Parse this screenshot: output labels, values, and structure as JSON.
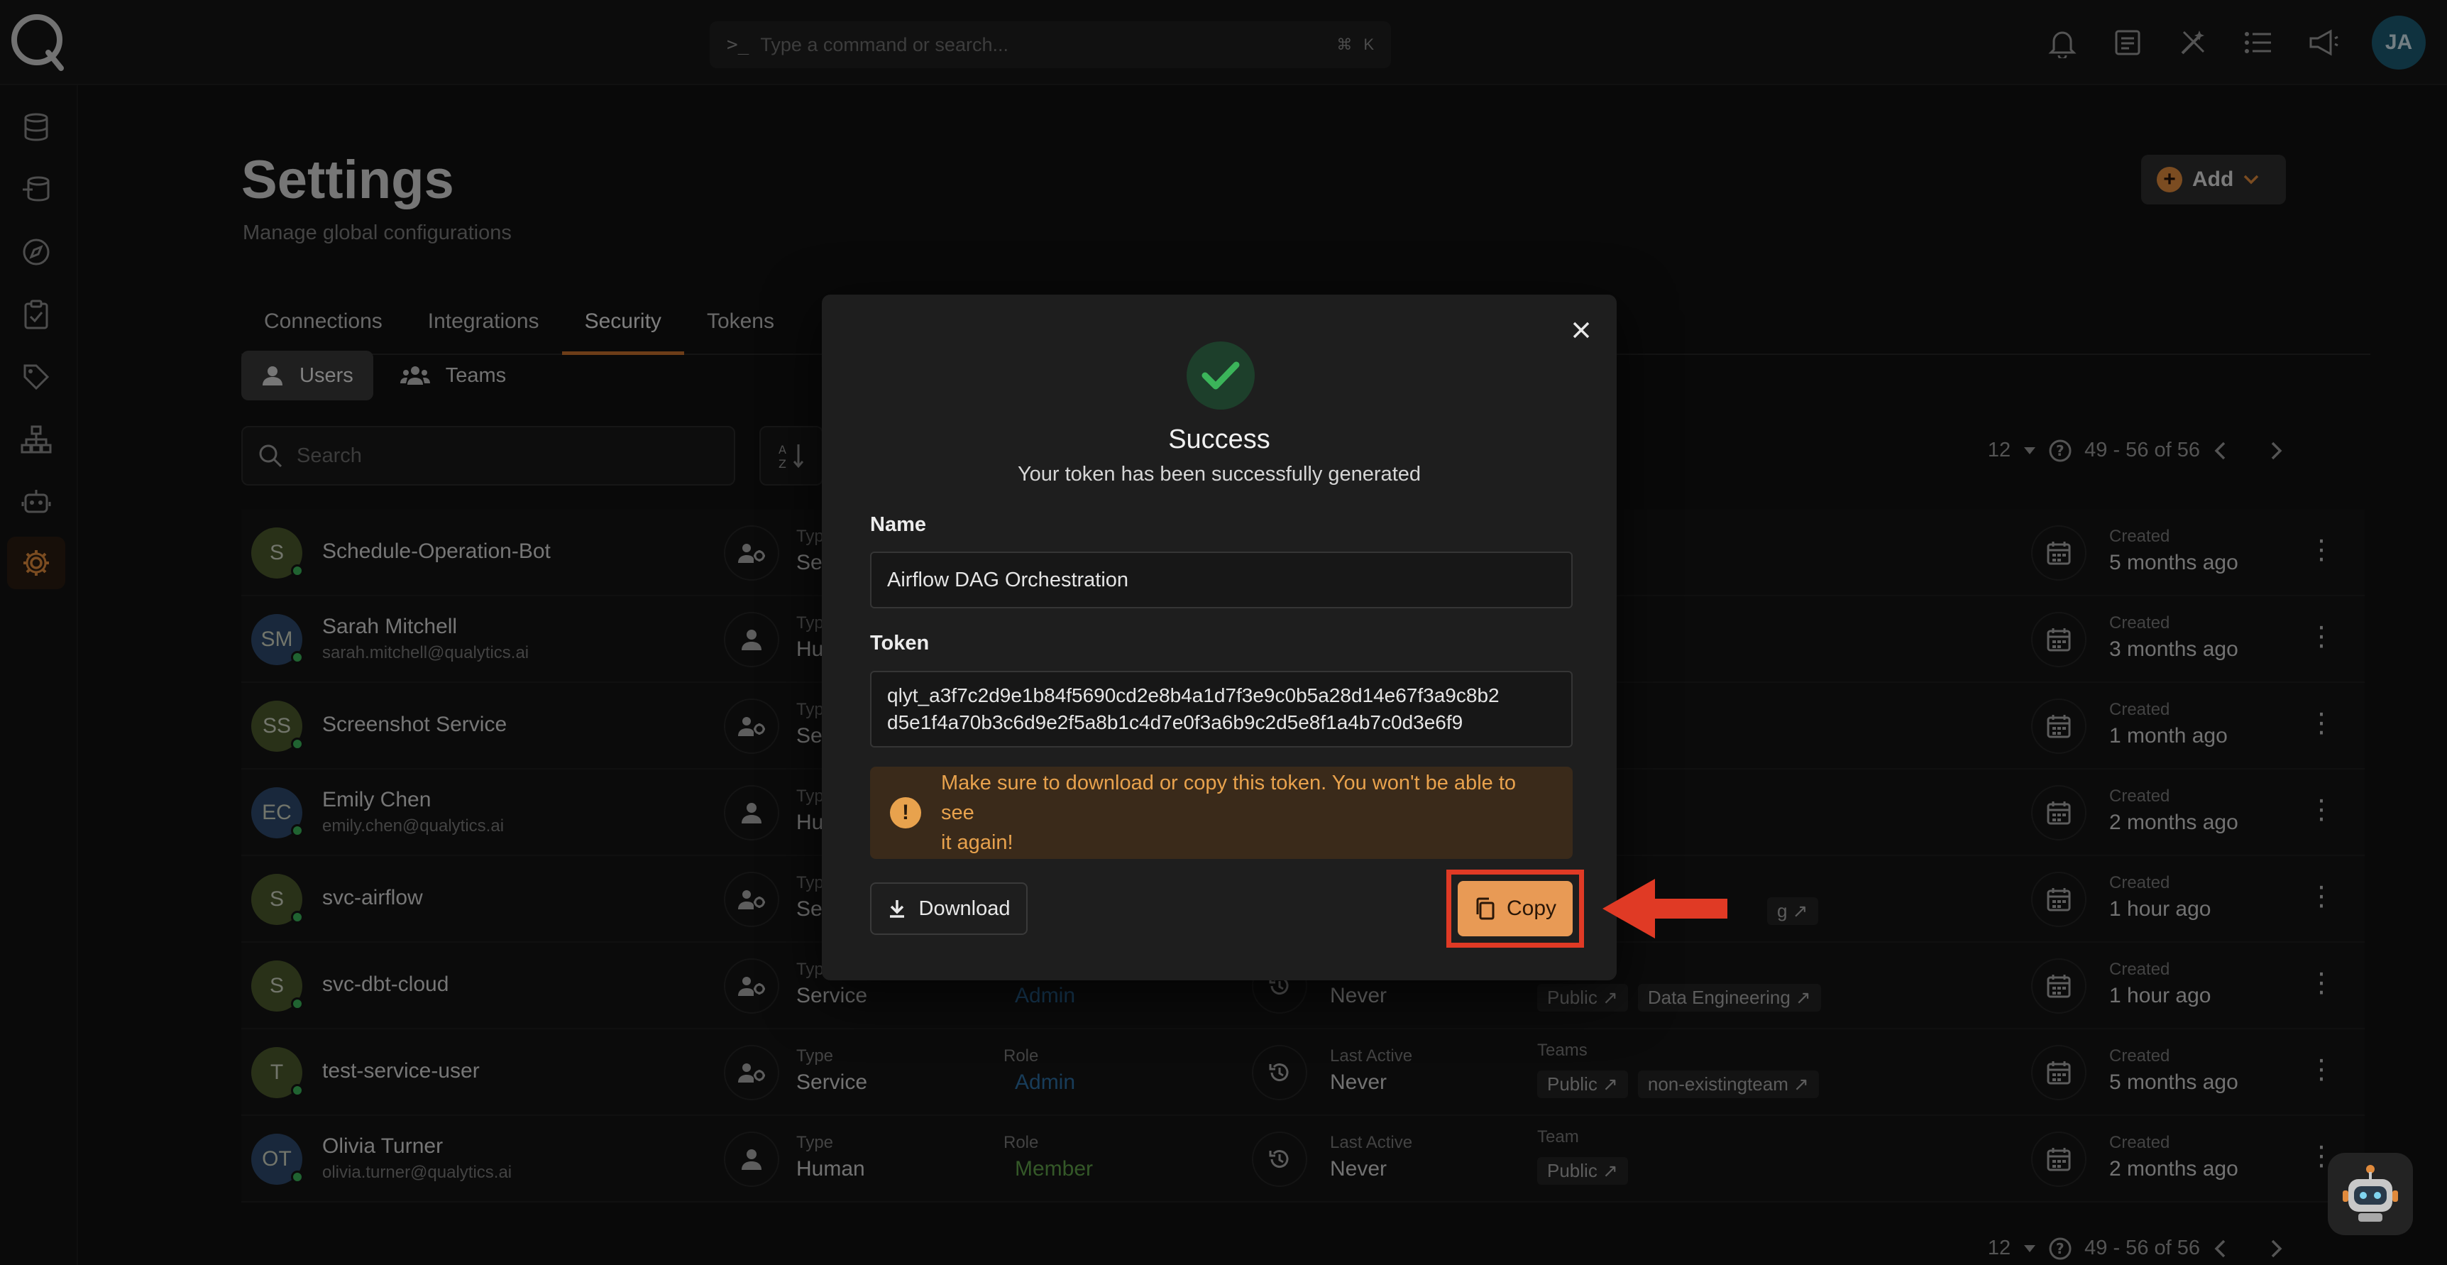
{
  "app": {
    "user_initials": "JA"
  },
  "command_bar": {
    "placeholder": "Type a command or search...",
    "prompt_glyph": ">_",
    "shortcut_cmd": "⌘",
    "shortcut_key": "K"
  },
  "page": {
    "title": "Settings",
    "subtitle": "Manage global configurations",
    "add_label": "Add"
  },
  "tabs": [
    {
      "label": "Connections"
    },
    {
      "label": "Integrations"
    },
    {
      "label": "Security",
      "active": true
    },
    {
      "label": "Tokens"
    }
  ],
  "segments": {
    "users": "Users",
    "teams": "Teams"
  },
  "search": {
    "placeholder": "Search"
  },
  "pagination": {
    "page_size": "12",
    "range": "49 - 56 of 56"
  },
  "labels": {
    "type": "Type",
    "role": "Role",
    "last_active": "Last Active",
    "teams": "Teams",
    "team": "Team",
    "created": "Created"
  },
  "users": [
    {
      "initials": "S",
      "name": "Schedule-Operation-Bot",
      "email": "",
      "type": "Service",
      "role": "",
      "last_active": "",
      "teams_label": "",
      "teams": [],
      "created": "5 months ago",
      "avatar_color": "#4b5a2d"
    },
    {
      "initials": "SM",
      "name": "Sarah Mitchell",
      "email": "sarah.mitchell@qualytics.ai",
      "type": "Human",
      "role": "",
      "last_active": "",
      "teams_label": "",
      "teams": [],
      "created": "3 months ago",
      "avatar_color": "#2f4a6e"
    },
    {
      "initials": "SS",
      "name": "Screenshot Service",
      "email": "",
      "type": "Service",
      "role": "",
      "last_active": "",
      "teams_label": "",
      "teams": [],
      "created": "1 month ago",
      "avatar_color": "#4b5a2d"
    },
    {
      "initials": "EC",
      "name": "Emily Chen",
      "email": "emily.chen@qualytics.ai",
      "type": "Human",
      "role": "",
      "last_active": "",
      "teams_label": "",
      "teams": [],
      "created": "2 months ago",
      "avatar_color": "#2f4a6e"
    },
    {
      "initials": "S",
      "name": "svc-airflow",
      "email": "",
      "type": "Service",
      "role": "",
      "last_active": "",
      "teams_label": "",
      "teams": [
        "g"
      ],
      "created": "1 hour ago",
      "avatar_color": "#4b5a2d"
    },
    {
      "initials": "S",
      "name": "svc-dbt-cloud",
      "email": "",
      "type": "Service",
      "role": "Admin",
      "last_active": "Never",
      "teams_label": "",
      "teams": [
        "Public",
        "Data Engineering"
      ],
      "created": "1 hour ago",
      "avatar_color": "#4b5a2d"
    },
    {
      "initials": "T",
      "name": "test-service-user",
      "email": "",
      "type": "Service",
      "role": "Admin",
      "last_active": "Never",
      "teams_label": "Teams",
      "teams": [
        "Public",
        "non-existingteam"
      ],
      "created": "5 months ago",
      "avatar_color": "#4b5a2d"
    },
    {
      "initials": "OT",
      "name": "Olivia Turner",
      "email": "olivia.turner@qualytics.ai",
      "type": "Human",
      "role": "Member",
      "last_active": "Never",
      "teams_label": "Team",
      "teams": [
        "Public"
      ],
      "created": "2 months ago",
      "avatar_color": "#2f4a6e"
    }
  ],
  "modal": {
    "title": "Success",
    "subtitle": "Your token has been successfully generated",
    "name_label": "Name",
    "name_value": "Airflow DAG Orchestration",
    "token_label": "Token",
    "token_line1": "qlyt_a3f7c2d9e1b84f5690cd2e8b4a1d7f3e9c0b5a28d14e67f3a9c8b2",
    "token_line2": "d5e1f4a70b3c6d9e2f5a8b1c4d7e0f3a6b9c2d5e8f1a4b7c0d3e6f9",
    "warning_line1": "Make sure to download or copy this token. You won't be able to see",
    "warning_line2": "it again!",
    "download_label": "Download",
    "copy_label": "Copy"
  },
  "colors": {
    "accent": "#e08a3c",
    "highlight": "#e03a25",
    "success": "#3bb55a",
    "warning": "#e8a24d"
  }
}
